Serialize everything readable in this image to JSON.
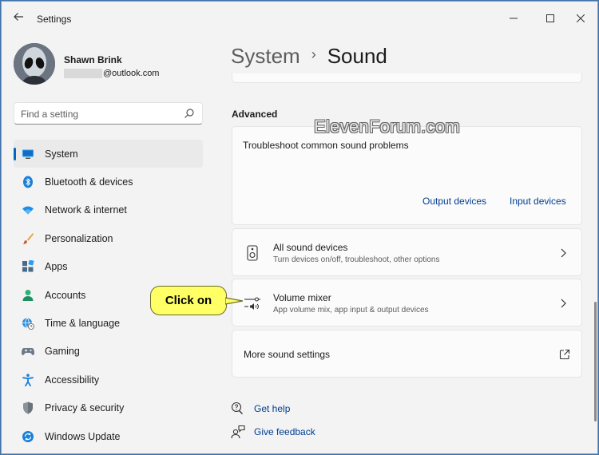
{
  "window": {
    "title": "Settings"
  },
  "profile": {
    "name": "Shawn Brink",
    "email_suffix": "@outlook.com"
  },
  "search": {
    "placeholder": "Find a setting"
  },
  "nav": {
    "items": [
      {
        "label": "System",
        "icon": "monitor-icon",
        "active": true
      },
      {
        "label": "Bluetooth & devices",
        "icon": "bluetooth-icon"
      },
      {
        "label": "Network & internet",
        "icon": "wifi-icon"
      },
      {
        "label": "Personalization",
        "icon": "brush-icon"
      },
      {
        "label": "Apps",
        "icon": "apps-icon"
      },
      {
        "label": "Accounts",
        "icon": "person-icon"
      },
      {
        "label": "Time & language",
        "icon": "globe-clock-icon"
      },
      {
        "label": "Gaming",
        "icon": "gamepad-icon"
      },
      {
        "label": "Accessibility",
        "icon": "accessibility-icon"
      },
      {
        "label": "Privacy & security",
        "icon": "shield-icon"
      },
      {
        "label": "Windows Update",
        "icon": "update-icon"
      }
    ]
  },
  "breadcrumb": {
    "parent": "System",
    "separator": "›",
    "current": "Sound"
  },
  "advanced": {
    "heading": "Advanced",
    "troubleshoot": {
      "title": "Troubleshoot common sound problems",
      "links": [
        "Output devices",
        "Input devices"
      ]
    },
    "all_devices": {
      "title": "All sound devices",
      "subtitle": "Turn devices on/off, troubleshoot, other options"
    },
    "volume_mixer": {
      "title": "Volume mixer",
      "subtitle": "App volume mix, app input & output devices"
    },
    "more_settings": {
      "title": "More sound settings"
    }
  },
  "help": {
    "get_help": "Get help",
    "give_feedback": "Give feedback"
  },
  "annotation": {
    "callout": "Click on",
    "watermark": "ElevenForum.com"
  },
  "colors": {
    "accent": "#0067c0",
    "link": "#003e92",
    "callout": "#ffff66"
  }
}
